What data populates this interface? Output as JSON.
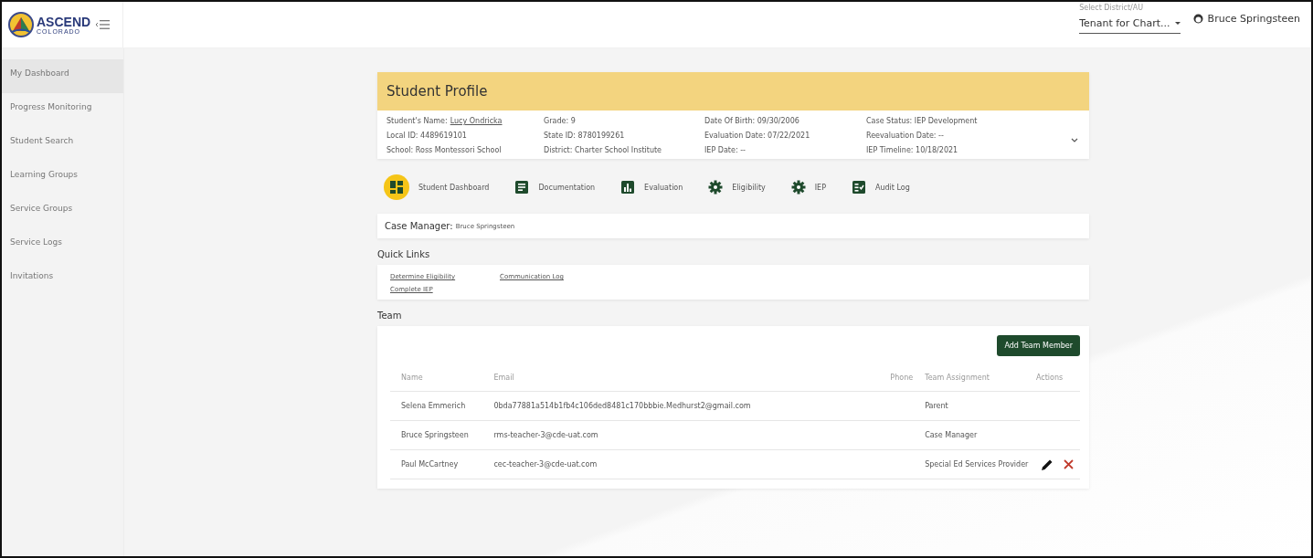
{
  "logo": {
    "title": "ASCEND",
    "subtitle": "COLORADO"
  },
  "header": {
    "district_label": "Select District/AU",
    "district_value": "Tenant for Chart...",
    "user": "Bruce Springsteen"
  },
  "sidebar": {
    "items": [
      {
        "label": "My Dashboard",
        "selected": true
      },
      {
        "label": "Progress Monitoring",
        "selected": false
      },
      {
        "label": "Student Search",
        "selected": false
      },
      {
        "label": "Learning Groups",
        "selected": false
      },
      {
        "label": "Service Groups",
        "selected": false
      },
      {
        "label": "Service Logs",
        "selected": false
      },
      {
        "label": "Invitations",
        "selected": false
      }
    ]
  },
  "profile": {
    "title": "Student Profile",
    "columns": [
      [
        {
          "label": "Student's Name:",
          "value": "Lucy Ondricka",
          "kind": "link"
        },
        {
          "text": "Local ID: 4489619101",
          "kind": "text"
        },
        {
          "text": "School: Ross Montessori School",
          "kind": "text"
        }
      ],
      [
        {
          "text": "Grade: 9",
          "kind": "text"
        },
        {
          "text": "State ID: 8780199261",
          "kind": "text"
        },
        {
          "text": "District: Charter School Institute",
          "kind": "text"
        }
      ],
      [
        {
          "text": "Date Of Birth: 09/30/2006",
          "kind": "text"
        },
        {
          "text": "Evaluation Date: 07/22/2021",
          "kind": "text"
        },
        {
          "text": "IEP Date: --",
          "kind": "text"
        }
      ],
      [
        {
          "text": "Case Status: IEP Development",
          "kind": "text"
        },
        {
          "text": "Reevaluation Date: --",
          "kind": "text"
        },
        {
          "text": "IEP Timeline: 10/18/2021",
          "kind": "text"
        }
      ]
    ]
  },
  "tabs": [
    {
      "label": "Student Dashboard",
      "kind": "dashboard",
      "selected": true
    },
    {
      "label": "Documentation",
      "kind": "document",
      "selected": false
    },
    {
      "label": "Evaluation",
      "kind": "chart",
      "selected": false
    },
    {
      "label": "Eligibility",
      "kind": "gear",
      "selected": false
    },
    {
      "label": "IEP",
      "kind": "gear",
      "selected": false
    },
    {
      "label": "Audit Log",
      "kind": "checklist",
      "selected": false
    }
  ],
  "case_manager": {
    "label": "Case Manager:",
    "value": "Bruce Springsteen"
  },
  "quick_links": {
    "title": "Quick Links",
    "links": [
      "Determine Eligibility",
      "Communication Log",
      "Complete IEP"
    ]
  },
  "team": {
    "title": "Team",
    "add_button": "Add Team Member",
    "columns": [
      "Name",
      "Email",
      "Phone",
      "Team Assignment",
      "Actions"
    ],
    "rows": [
      {
        "name": "Selena Emmerich",
        "email": "0bda77881a514b1fb4c106ded8481c170bbbie.Medhurst2@gmail.com",
        "assignment": "Parent",
        "editable": false
      },
      {
        "name": "Bruce Springsteen",
        "email": "rms-teacher-3@cde-uat.com",
        "assignment": "Case Manager",
        "editable": false
      },
      {
        "name": "Paul McCartney",
        "email": "cec-teacher-3@cde-uat.com",
        "assignment": "Special Ed Services Provider",
        "editable": true
      }
    ]
  }
}
